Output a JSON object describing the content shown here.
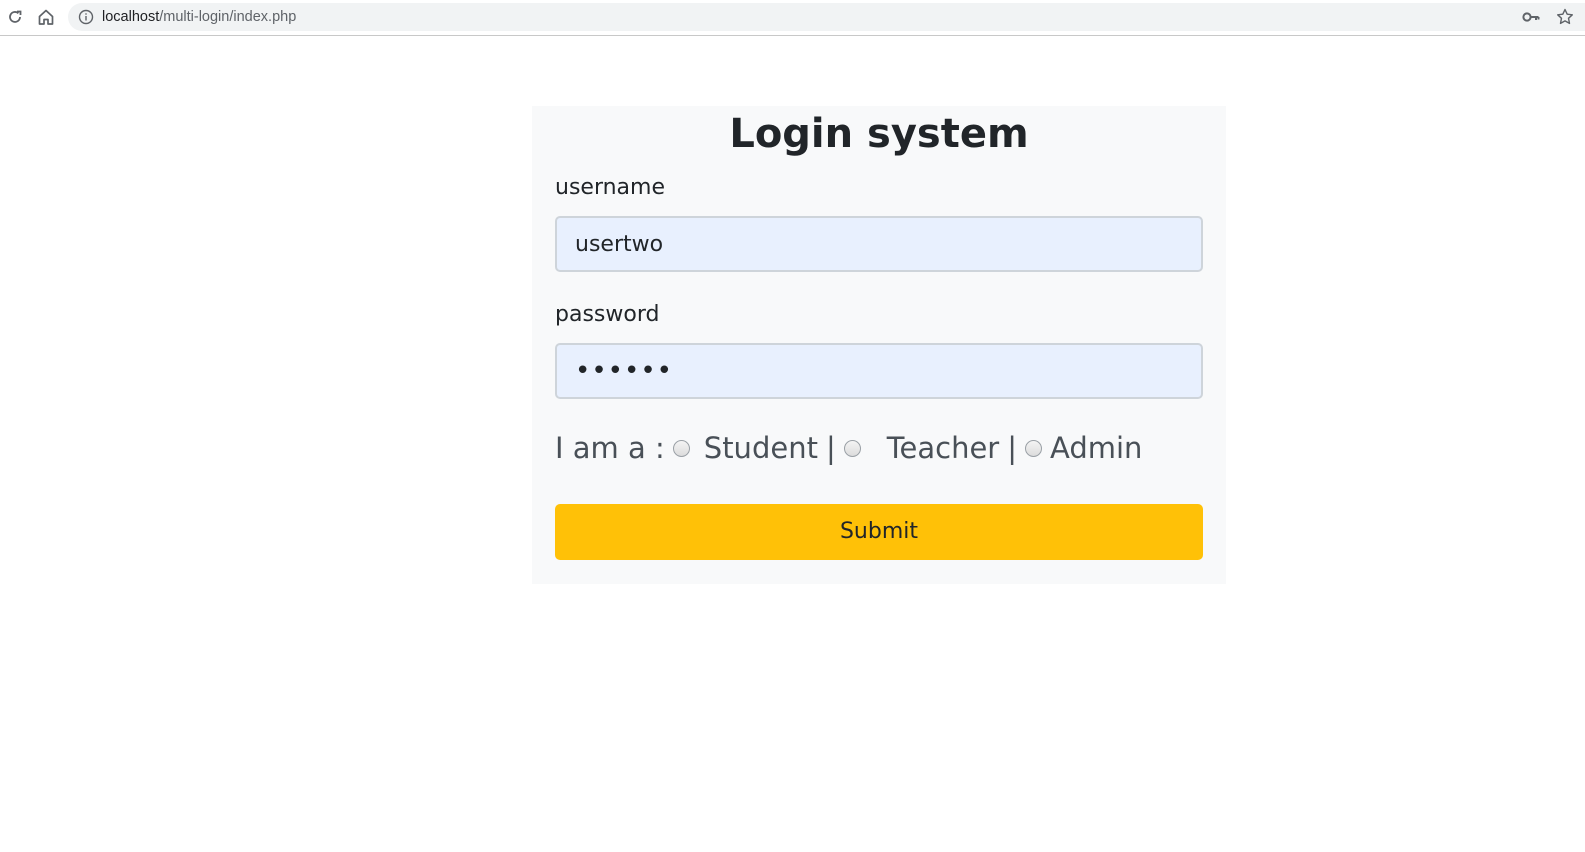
{
  "browser": {
    "url_host": "localhost",
    "url_path": "/multi-login/index.php",
    "icons": [
      "reload-icon",
      "home-icon",
      "info-icon",
      "key-icon",
      "star-icon"
    ]
  },
  "form": {
    "title": "Login system",
    "username_label": "username",
    "username_value": "usertwo",
    "password_label": "password",
    "password_value": "••••••",
    "role_prefix": "I am a :",
    "roles": [
      {
        "label": "Student",
        "separator": "|"
      },
      {
        "label": "Teacher",
        "separator": "|"
      },
      {
        "label": "Admin",
        "separator": ""
      }
    ],
    "submit_label": "Submit"
  },
  "colors": {
    "card_bg": "#f8f9fa",
    "input_autofill_bg": "#e8f0fe",
    "submit_bg": "#ffc107"
  }
}
